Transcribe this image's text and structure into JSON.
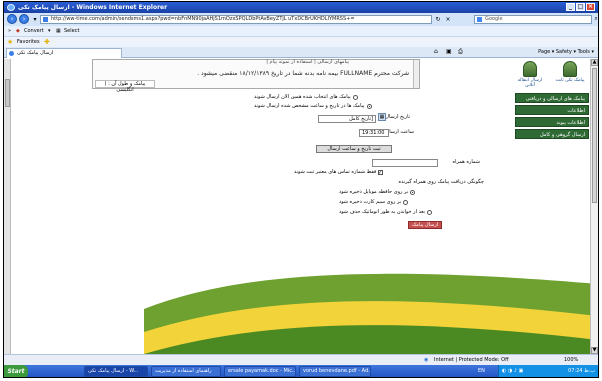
{
  "window": {
    "title": "ارسال پیامک تکی - Windows Internet Explorer",
    "buttons": [
      "_",
      "□",
      "×"
    ]
  },
  "address_bar": {
    "url": "http://ww-time.com/admin/sendsms1.aspx?pwd=nbFnMN90jaAHjS1mOzxSPQLDbPtAvBeyZTjL uTxDCBrUKHDLIYMRSS+=",
    "search_placeholder": "Google"
  },
  "toolbar": {
    "convert_label": "Convert",
    "select_label": "Select"
  },
  "favorites": {
    "label": "Favorites"
  },
  "tab": {
    "label": "ارسال پیامک تکی"
  },
  "command_bar": {
    "text": "Page ▾  Safety ▾  Tools ▾"
  },
  "message_box": {
    "tabs": "| پیامهای ارسالی | استفاده از نمونه پیام",
    "text": "شرکت محترم FULLNAME بیمه نامه بدنه شما در تاریخ ۱۸/۱۲/۱۳۸۹ منقضی میشود .",
    "counter": "( پیامک و طول آن : انگلیسی"
  },
  "sidebar": {
    "avatar1_caption": "پیامک تکی ثابت",
    "avatar2_caption": "ارسال انتقاله آنلاین",
    "menu": [
      "پیامک های ارسالی و دریافتی",
      "اطلاعات",
      "اطلاعات پیوند",
      "ارسال گروهی و کامل"
    ]
  },
  "form": {
    "send_now_label": "پیامک های انتخاب شده همین الان ارسال شوند",
    "send_schedule_label": "پیامک ها در تاریخ و ساعت مشخص شده ارسال شوند",
    "date_label": "تاریخ ارسال :",
    "date_value": "[تاریخ کامل",
    "time_label": "ساعت ارسال :",
    "time_value": "19:31:00",
    "set_time_button": "ثبت تاریخ و ساعت ارسال",
    "mobile_label": "شماره همراه",
    "save_numbers_label": "فقط شماره تماس های معتبر ثبت شوند",
    "receive_label": "چگونگی دریافت پیامک روی همراه گیرنده",
    "option_memory": "بر روی حافظه موبایل ذخیره شود",
    "option_sim": "بر روی سیم کارت ذخیره شود",
    "option_delete": "بعد از خواندن به طور اتوماتیک حذف شود",
    "send_button": "ارسال پیامک"
  },
  "status_bar": {
    "zone": "Internet | Protected Mode: Off",
    "zoom": "100%"
  },
  "taskbar": {
    "start": "Start",
    "tasks": [
      "ارسال پیامک تکی - W...",
      "راهنمای استفاده از مدیریت",
      "ersale payamak.doc - Mic...",
      "vorud benevdane.pdf - Ad..."
    ],
    "lang": "EN",
    "clock": "07:24 ب.ظ"
  },
  "colors": {
    "title_blue": "#1941a5",
    "sidebar_green": "#2f6a35",
    "swoosh_green": "#6ea12f",
    "swoosh_yellow": "#f2d33a"
  }
}
